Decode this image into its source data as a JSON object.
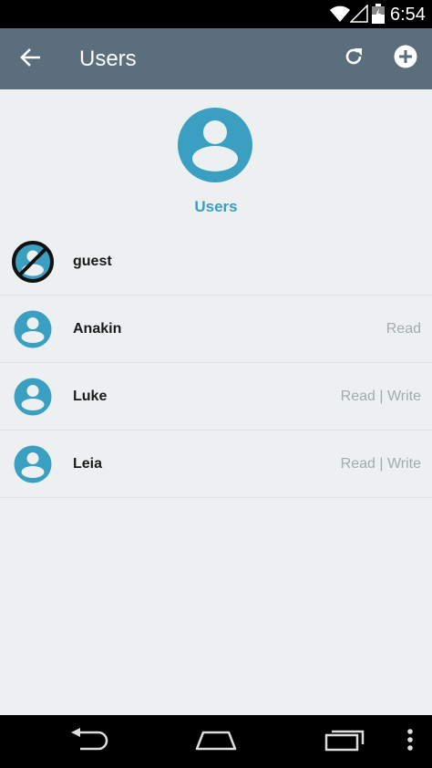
{
  "status_bar": {
    "time": "6:54",
    "icons": [
      "wifi-icon",
      "signal-icon",
      "battery-icon"
    ]
  },
  "app_bar": {
    "title": "Users",
    "actions": [
      "back-arrow-icon",
      "refresh-icon",
      "add-circle-icon"
    ]
  },
  "header": {
    "label": "Users",
    "icon": "user-group-icon"
  },
  "users": [
    {
      "name": "guest",
      "permissions": "",
      "icon": "guest-disabled-icon"
    },
    {
      "name": "Anakin",
      "permissions": "Read",
      "icon": "user-icon"
    },
    {
      "name": "Luke",
      "permissions": "Read | Write",
      "icon": "user-icon"
    },
    {
      "name": "Leia",
      "permissions": "Read | Write",
      "icon": "user-icon"
    }
  ],
  "nav_bar": {
    "icons": [
      "nav-back-icon",
      "nav-home-icon",
      "nav-recents-icon",
      "overflow-menu-icon"
    ]
  },
  "colors": {
    "app_bar": "#5b6e7b",
    "accent": "#3a9fc1",
    "background": "#ecf0f1",
    "secondary_text": "#a4aaae"
  }
}
